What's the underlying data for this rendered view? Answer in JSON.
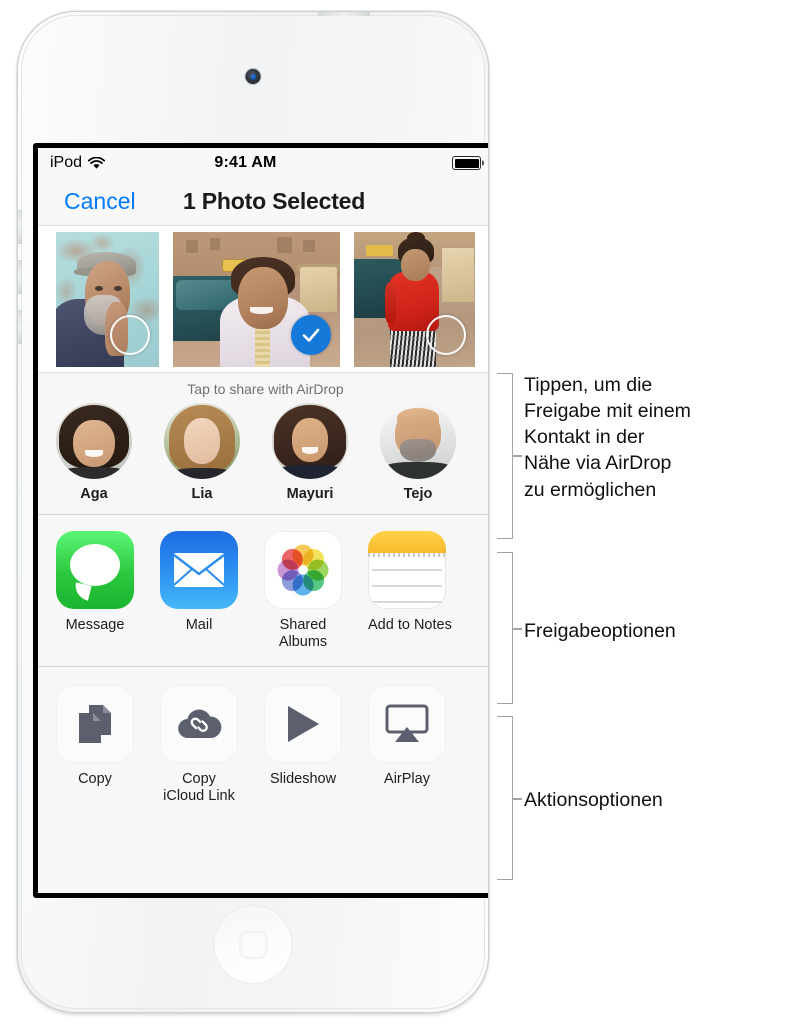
{
  "device": {
    "name": "ipod-touch"
  },
  "status_bar": {
    "carrier": "iPod",
    "wifi_icon": "wifi-icon",
    "time": "9:41 AM",
    "battery_icon": "battery-full-icon"
  },
  "nav_bar": {
    "cancel_label": "Cancel",
    "title": "1 Photo Selected"
  },
  "photo_strip": {
    "photos": [
      {
        "id": "photo-1",
        "description": "Older man in navy shirt and flat cap against teal wall",
        "selected": false
      },
      {
        "id": "photo-2",
        "description": "Smiling girl in embroidered white tunic in front of teal car",
        "selected": true
      },
      {
        "id": "photo-3",
        "description": "Woman in red top and striped trousers beside taxi",
        "selected": false
      }
    ],
    "checkmark_color": "#1579d9"
  },
  "airdrop": {
    "title": "Tap to share with AirDrop",
    "contacts": [
      {
        "name": "Aga"
      },
      {
        "name": "Lia"
      },
      {
        "name": "Mayuri"
      },
      {
        "name": "Tejo"
      }
    ]
  },
  "share_options": [
    {
      "label": "Message",
      "icon": "message-icon"
    },
    {
      "label": "Mail",
      "icon": "mail-icon"
    },
    {
      "label": "Shared Albums",
      "icon": "photos-icon"
    },
    {
      "label": "Add to Notes",
      "icon": "notes-icon"
    }
  ],
  "action_options": [
    {
      "label": "Copy",
      "icon": "copy-icon"
    },
    {
      "label": "Copy iCloud Link",
      "icon": "icloud-link-icon"
    },
    {
      "label": "Slideshow",
      "icon": "play-icon"
    },
    {
      "label": "AirPlay",
      "icon": "airplay-icon"
    }
  ],
  "annotations": [
    {
      "id": "airdrop-callout",
      "text": "Tippen, um die\nFreigabe mit einem\nKontakt in der\nNähe via AirDrop\nzu ermöglichen"
    },
    {
      "id": "share-callout",
      "text": "Freigabeoptionen"
    },
    {
      "id": "action-callout",
      "text": "Aktionsoptionen"
    }
  ],
  "colors": {
    "accent_blue": "#007aff",
    "selection_blue": "#1579d9",
    "screen_bg": "#f7f7f7",
    "separator": "#d8d8d8",
    "bracket": "#a3a3a3"
  }
}
